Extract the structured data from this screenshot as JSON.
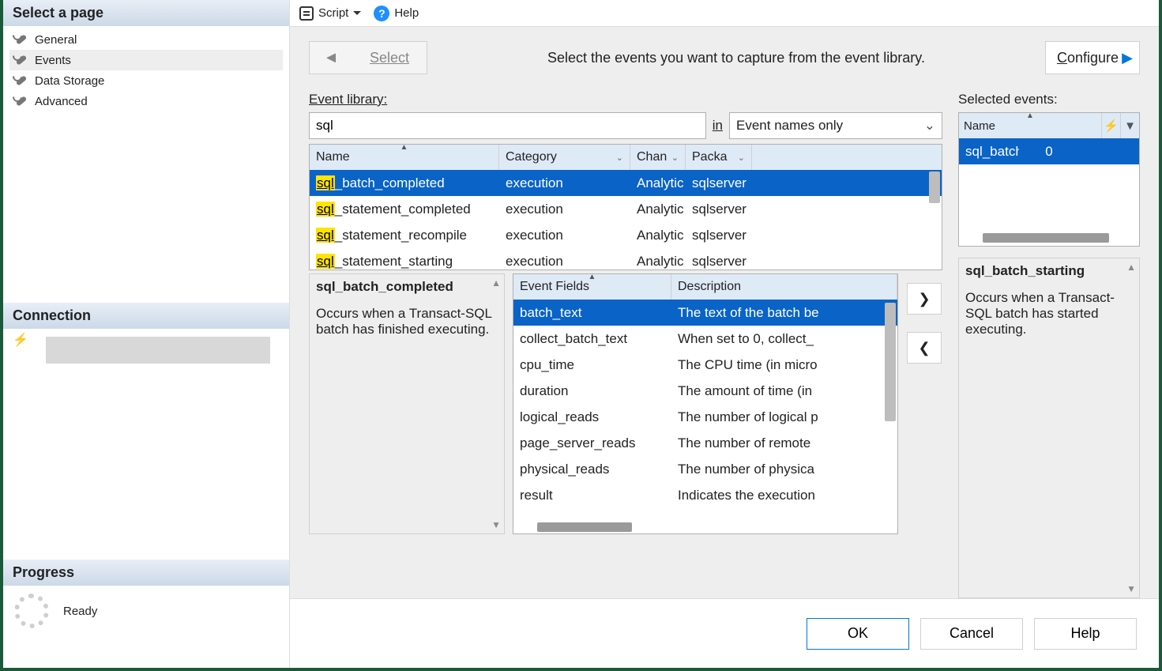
{
  "sidebar": {
    "title": "Select a page",
    "items": [
      {
        "label": "General"
      },
      {
        "label": "Events"
      },
      {
        "label": "Data Storage"
      },
      {
        "label": "Advanced"
      }
    ],
    "connection_title": "Connection",
    "progress_title": "Progress",
    "progress_status": "Ready"
  },
  "toolbar": {
    "script_label": "Script",
    "help_label": "Help"
  },
  "toprow": {
    "select_label": "Select",
    "instruction": "Select the events you want to capture from the event library.",
    "configure_label": "Configure"
  },
  "library": {
    "label": "Event library:",
    "search_value": "sql",
    "in_label": "in",
    "scope_value": "Event names only",
    "columns": {
      "name": "Name",
      "category": "Category",
      "channel": "Chan",
      "package": "Packa"
    },
    "rows": [
      {
        "match": "sql",
        "rest": "_batch_completed",
        "category": "execution",
        "channel": "Analytic",
        "package": "sqlserver",
        "selected": true
      },
      {
        "match": "sql",
        "rest": "_statement_completed",
        "category": "execution",
        "channel": "Analytic",
        "package": "sqlserver",
        "selected": false
      },
      {
        "match": "sql",
        "rest": "_statement_recompile",
        "category": "execution",
        "channel": "Analytic",
        "package": "sqlserver",
        "selected": false
      },
      {
        "match": "sql",
        "rest": "_statement_starting",
        "category": "execution",
        "channel": "Analytic",
        "package": "sqlserver",
        "selected": false
      }
    ]
  },
  "detail": {
    "title": "sql_batch_completed",
    "description": "Occurs when a Transact-SQL batch has finished executing."
  },
  "fields": {
    "columns": {
      "name": "Event Fields",
      "desc": "Description"
    },
    "rows": [
      {
        "name": "batch_text",
        "desc": "The text of the batch be",
        "selected": true
      },
      {
        "name": "collect_batch_text",
        "desc": "When set to 0, collect_",
        "selected": false
      },
      {
        "name": "cpu_time",
        "desc": "The CPU time (in micro",
        "selected": false
      },
      {
        "name": "duration",
        "desc": "The amount of time (in ",
        "selected": false
      },
      {
        "name": "logical_reads",
        "desc": "The number of logical p",
        "selected": false
      },
      {
        "name": "page_server_reads",
        "desc": "The number of remote ",
        "selected": false
      },
      {
        "name": "physical_reads",
        "desc": "The number of physica",
        "selected": false
      },
      {
        "name": "result",
        "desc": "Indicates the execution",
        "selected": false
      }
    ]
  },
  "selected": {
    "label": "Selected events:",
    "columns": {
      "name": "Name"
    },
    "rows": [
      {
        "name": "sql_batch_starting",
        "count": "0"
      }
    ],
    "detail_title": "sql_batch_starting",
    "detail_desc": "Occurs when a Transact-SQL batch has started executing."
  },
  "footer": {
    "ok": "OK",
    "cancel": "Cancel",
    "help": "Help"
  }
}
